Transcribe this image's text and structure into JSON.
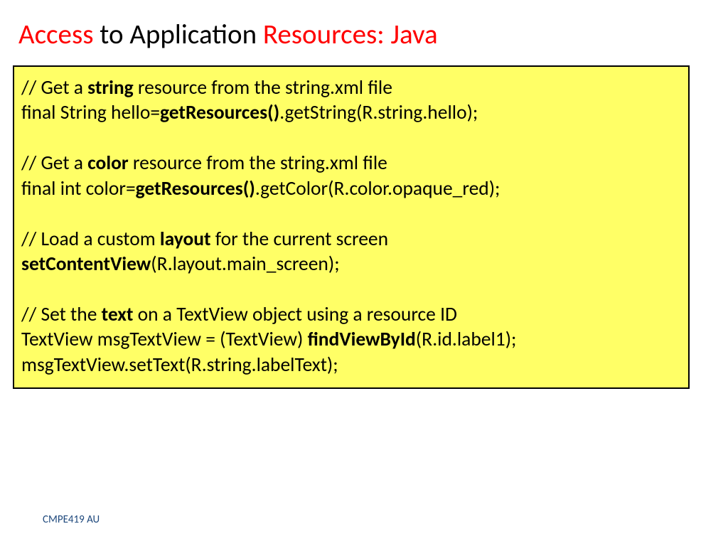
{
  "title": {
    "part1": "Access",
    "part2": " to Application ",
    "part3": "Resources: Java"
  },
  "code": {
    "l1a": "// Get a ",
    "l1b": "string",
    "l1c": " resource from the string.xml file",
    "l2a": "final String hello=",
    "l2b": "getResources()",
    "l2c": ".getString(R.string.hello);",
    "l3a": "// Get a ",
    "l3b": "color",
    "l3c": " resource from the string.xml file",
    "l4a": "final int color=",
    "l4b": "getResources()",
    "l4c": ".getColor(R.color.opaque_red);",
    "l5a": "// Load a custom ",
    "l5b": "layout",
    "l5c": " for the current screen",
    "l6a": "setContentView",
    "l6b": "(R.layout.main_screen);",
    "l7a": "// Set the ",
    "l7b": "text",
    "l7c": " on a TextView object using a resource ID",
    "l8a": "TextView msgTextView = (TextView) ",
    "l8b": "findViewById",
    "l8c": "(R.id.label1);",
    "l9": "msgTextView.setText(R.string.labelText);"
  },
  "footer": "CMPE419 AU"
}
